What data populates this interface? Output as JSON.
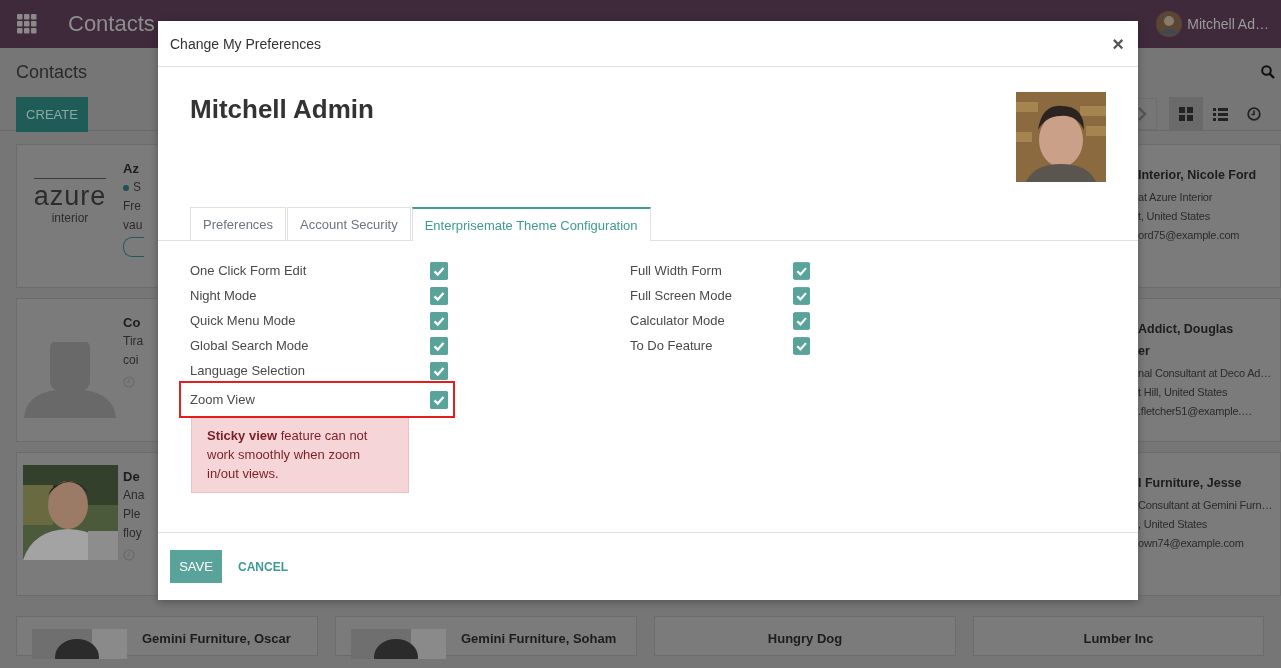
{
  "topbar": {
    "app_title": "Contacts",
    "user_name": "Mitchell Ad…"
  },
  "control_panel": {
    "breadcrumb": "Contacts",
    "create_button": "CREATE",
    "views": [
      {
        "kind": "kanban",
        "selected": true
      },
      {
        "kind": "list",
        "selected": false
      },
      {
        "kind": "activity",
        "selected": false
      }
    ]
  },
  "left_cards": [
    {
      "kind": "logo",
      "logo_main": "azure",
      "logo_sub": "interior",
      "lines": [
        {
          "text": "Az",
          "kind": "title"
        },
        {
          "text": "S",
          "kind": "status"
        },
        {
          "text": "Fre",
          "kind": "text"
        },
        {
          "text": "vau",
          "kind": "text"
        },
        {
          "kind": "tag"
        }
      ]
    },
    {
      "kind": "silhouette",
      "lines": [
        {
          "text": "Co",
          "kind": "title"
        },
        {
          "text": "Tira",
          "kind": "text"
        },
        {
          "text": "coi",
          "kind": "text"
        },
        {
          "kind": "clock"
        }
      ]
    },
    {
      "kind": "picture",
      "lines": [
        {
          "text": "De",
          "kind": "title"
        },
        {
          "text": "Ana",
          "kind": "text"
        },
        {
          "text": "Ple",
          "kind": "text"
        },
        {
          "text": "floy",
          "kind": "text"
        },
        {
          "kind": "clock"
        }
      ]
    }
  ],
  "right_cards": [
    {
      "lines": [
        {
          "text": "Interior, Nicole Ford",
          "kind": "title"
        },
        {
          "text": "at Azure Interior",
          "kind": "text"
        },
        {
          "text": "t, United States",
          "kind": "text"
        },
        {
          "text": "ord75@example.com",
          "kind": "text"
        }
      ]
    },
    {
      "lines": [
        {
          "text": "Addict, Douglas",
          "kind": "title"
        },
        {
          "text": "er",
          "kind": "title"
        },
        {
          "text": "nal Consultant at Deco Ad…",
          "kind": "text"
        },
        {
          "text": "t Hill, United States",
          "kind": "text"
        },
        {
          "text": ".fletcher51@example.…",
          "kind": "text"
        }
      ]
    },
    {
      "lines": [
        {
          "text": "l Furniture, Jesse",
          "kind": "title"
        },
        {
          "text": "Consultant at Gemini Furn…",
          "kind": "text"
        },
        {
          "text": ", United States",
          "kind": "text"
        },
        {
          "text": "own74@example.com",
          "kind": "text"
        }
      ]
    }
  ],
  "bottom_cards": [
    {
      "name": "Gemini Furniture, Oscar",
      "kind": "picture"
    },
    {
      "name": "Gemini Furniture, Soham",
      "kind": "picture"
    },
    {
      "name": "Hungry Dog",
      "kind": "none"
    },
    {
      "name": "Lumber Inc",
      "kind": "none"
    }
  ],
  "dialog": {
    "title": "Change My Preferences",
    "close": "×",
    "user_name": "Mitchell Admin",
    "tabs": [
      {
        "label": "Preferences",
        "selected": false
      },
      {
        "label": "Account Security",
        "selected": false
      },
      {
        "label": "Enterprisemate Theme Configuration",
        "selected": true
      }
    ],
    "left_options": [
      {
        "label": "One Click Form Edit",
        "checked": true,
        "highlighted": false
      },
      {
        "label": "Night Mode",
        "checked": true,
        "highlighted": false
      },
      {
        "label": "Quick Menu Mode",
        "checked": true,
        "highlighted": false
      },
      {
        "label": "Global Search Mode",
        "checked": true,
        "highlighted": false
      },
      {
        "label": "Language Selection",
        "checked": true,
        "highlighted": false
      },
      {
        "label": "Zoom View",
        "checked": true,
        "highlighted": true
      }
    ],
    "right_options": [
      {
        "label": "Full Width Form",
        "checked": true
      },
      {
        "label": "Full Screen Mode",
        "checked": true
      },
      {
        "label": "Calculator Mode",
        "checked": true
      },
      {
        "label": "To Do Feature",
        "checked": true
      }
    ],
    "warning": "**Sticky view** feature can not work smoothly when zoom in/out views.",
    "buttons": {
      "save": "SAVE",
      "cancel": "CANCEL"
    }
  }
}
